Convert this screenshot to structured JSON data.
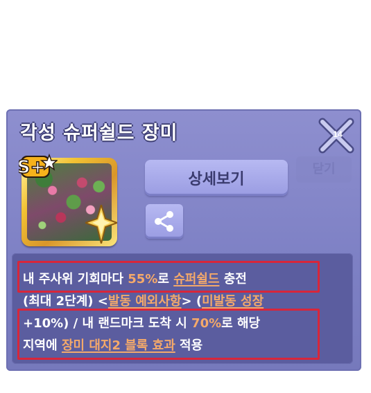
{
  "popup": {
    "title": "각성 슈퍼쉴드 장미",
    "close_badge": "14",
    "ghost_button": "닫기",
    "detail_button": "상세보기",
    "card_badge": "S+",
    "share_icon": "share-icon"
  },
  "description": {
    "line1_a": "내 주사위 기회마다 ",
    "line1_b": "55%",
    "line1_c": "로 ",
    "line1_d": "슈퍼쉴드",
    "line1_e": " 충전",
    "line2_a": "(최대 2단계) <",
    "line2_b": "발동 예외사항",
    "line2_c": "> (",
    "line2_d": "미발동 성장",
    "line3_a": "+10%) / 내 랜드마크 도착 시 ",
    "line3_b": "70%",
    "line3_c": "로 해당",
    "line4_a": "지역에 ",
    "line4_b": "장미 대지2 블록 효과",
    "line4_c": " 적용"
  },
  "colors": {
    "panel": "#7d80c4",
    "highlight": "#f4a96a",
    "annotation_box": "#d8263a"
  }
}
